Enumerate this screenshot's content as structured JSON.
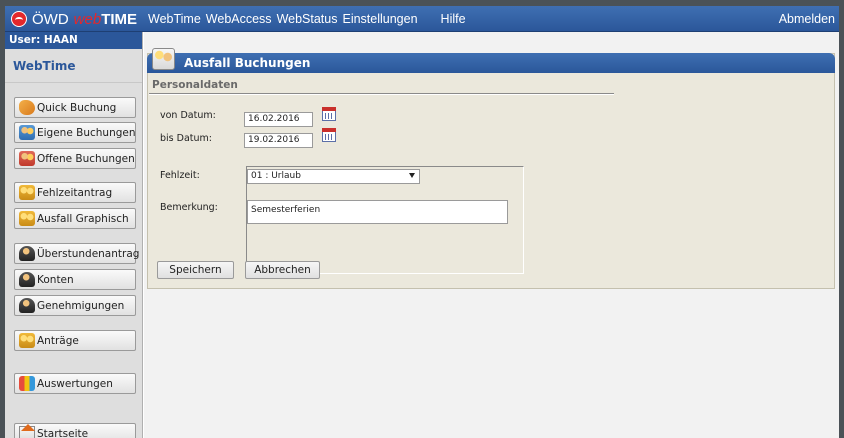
{
  "topbar": {
    "brand_owd": "ÖWD",
    "brand_web": "web",
    "brand_time": "TIME",
    "menu": [
      "WebTime",
      "WebAccess",
      "WebStatus",
      "Einstellungen",
      "Hilfe"
    ],
    "logout": "Abmelden"
  },
  "sidebar": {
    "user": "User: HAAN",
    "title": "WebTime",
    "buttons": [
      {
        "label": "Quick Buchung",
        "icon": "hand-icon"
      },
      {
        "label": "Eigene Buchungen",
        "icon": "people-icon"
      },
      {
        "label": "Offene Buchungen",
        "icon": "people-red-icon"
      },
      {
        "label": "Fehlzeitantrag",
        "icon": "people-gold-icon"
      },
      {
        "label": "Ausfall Graphisch",
        "icon": "people-icon"
      },
      {
        "label": "Überstundenantrag",
        "icon": "person-icon"
      },
      {
        "label": "Konten",
        "icon": "person-icon"
      },
      {
        "label": "Genehmigungen",
        "icon": "person-icon"
      },
      {
        "label": "Anträge",
        "icon": "people-icon"
      },
      {
        "label": "Auswertungen",
        "icon": "shapes-icon"
      },
      {
        "label": "Startseite",
        "icon": "house-icon"
      }
    ]
  },
  "panel": {
    "title": "Ausfall Buchungen",
    "section": "Personaldaten",
    "von_label": "von Datum:",
    "von_value": "16.02.2016",
    "bis_label": "bis Datum:",
    "bis_value": "19.02.2016",
    "fehlzeit_label": "Fehlzeit:",
    "fehlzeit_value": "01 : Urlaub",
    "bemerkung_label": "Bemerkung:",
    "bemerkung_value": "Semesterferien",
    "save": "Speichern",
    "cancel": "Abbrechen"
  },
  "colors": {
    "accent_blue": "#2b579a",
    "brand_red": "#e3282c",
    "panel_bg": "#ebe8dc",
    "sidebar_bg": "#dedede"
  }
}
